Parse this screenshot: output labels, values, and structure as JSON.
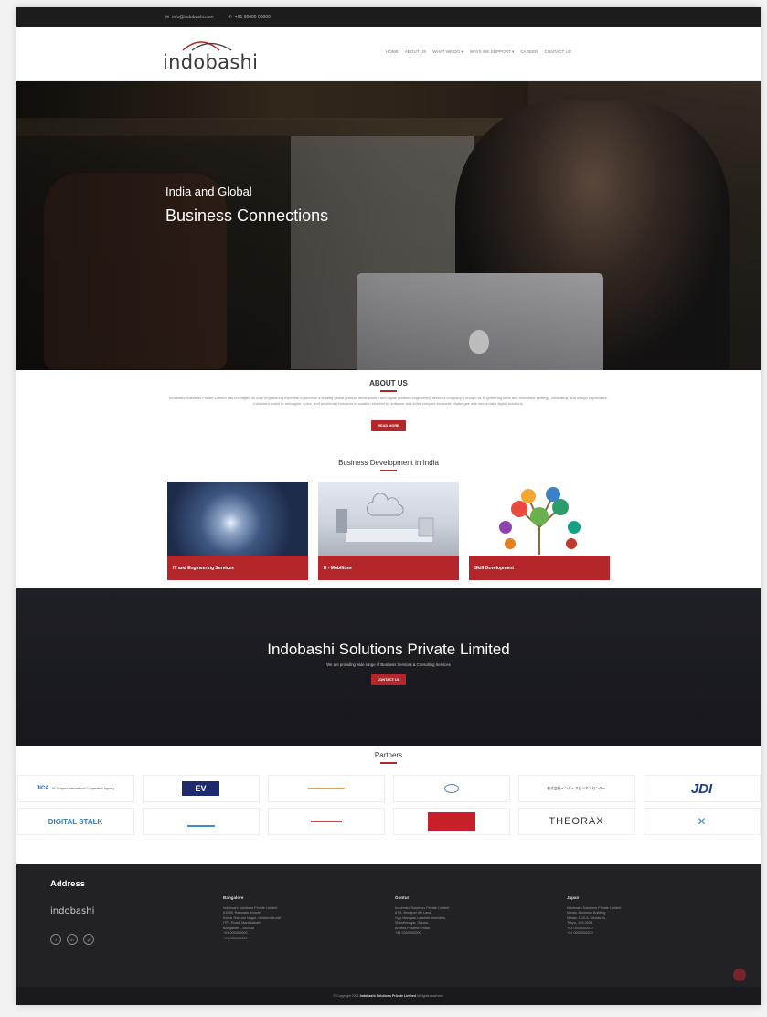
{
  "topbar": {
    "email": "info@indobashi.com",
    "phone": "+91 80000 00000"
  },
  "header": {
    "logo_text": "indobashi",
    "nav": [
      "HOME",
      "ABOUT US",
      "WHAT WE DO ▾",
      "WAYS WE SUPPORT ▾",
      "CAREER",
      "CONTACT US"
    ]
  },
  "hero": {
    "line1": "India and Global",
    "line2": "Business Connections"
  },
  "about": {
    "title": "ABOUT US",
    "text": "Indobashi Solutions Private Limited has leveraged its core engineering expertise to become a leading global product development and digital platform engineering services company. Through its Engineering skills and innovative strategy, consulting, and design capabilities, Indobashi works to reimagine, solve, and accelerate business innovation enabled by software and solve complex business challenges with world-class digital solutions.",
    "button": "READ MORE"
  },
  "business": {
    "title": "Business Development in India",
    "cards": [
      "IT and Engineering Services",
      "E - Mobilities",
      "Skill Development"
    ]
  },
  "banner": {
    "title": "Indobashi Solutions Private Limited",
    "subtitle": "We are providing wide range of Business Services & Consulting Services",
    "button": "CONTACT US"
  },
  "partners": {
    "title": "Partners",
    "logos": [
      "JICA Japan International Cooperation Agency",
      "EV",
      "",
      "",
      "株式会社インディアビジネスセンター",
      "JDI",
      "DIGITAL STALK",
      "",
      "",
      "",
      "THEORAX",
      ""
    ]
  },
  "footer": {
    "address_title": "Address",
    "logo_text": "indobashi",
    "social": [
      "f",
      "in",
      "yt"
    ],
    "columns": [
      {
        "title": "Bangalore",
        "lines": [
          "Indobashi Solutions Private Limited",
          "#1058, Ramaiah Arcade,",
          "Katha Telecom Nagar, Doddanekundi",
          "ITPL Road, Marathahalli",
          "Bangalore – 560048",
          "+91 000000000",
          "+91 000000000"
        ]
      },
      {
        "title": "Guntur",
        "lines": [
          "Indobashi Solutions Private Limited",
          "#7/3, Brodipet 4th Lane,",
          "Opp.Mangala Lakshmi Jewellers,",
          "Shanthinagar, Guntur,",
          "Andhra Pradesh, India",
          "+91 0000000000"
        ]
      },
      {
        "title": "Japan",
        "lines": [
          "Indobashi Solutions Private Limited",
          "Minato Business Building",
          "Minato 1-10-8, Minato-ku,",
          "Tokyo, 105-0003",
          "+81 0000000000",
          "+81 0000000000"
        ]
      }
    ],
    "copyright_pre": "© Copyright 2021",
    "copyright_company": "Indobashi Solutions Private Limited",
    "copyright_post": "All rights reserved."
  },
  "colors": {
    "accent": "#b5262b",
    "dark": "#1c1c1c"
  }
}
